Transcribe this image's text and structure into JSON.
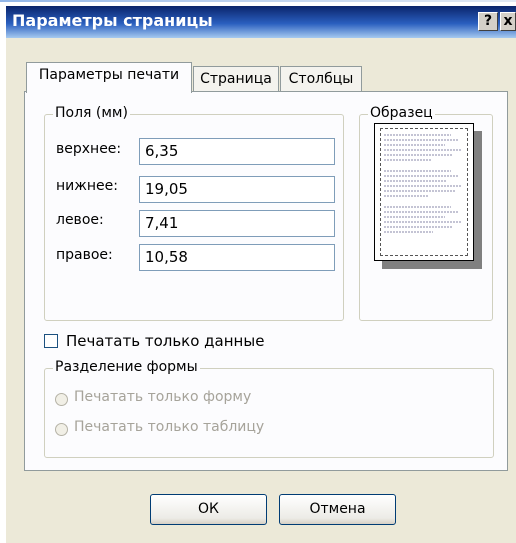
{
  "window": {
    "title": "Параметры страницы",
    "help_label": "?",
    "close_label": "x"
  },
  "tabs": [
    {
      "label": "Параметры печати",
      "active": true
    },
    {
      "label": "Страница",
      "active": false
    },
    {
      "label": "Столбцы",
      "active": false
    }
  ],
  "margins": {
    "legend": "Поля (мм)",
    "top": {
      "label": "верхнее:",
      "value": "6,35"
    },
    "bottom": {
      "label": "нижнее:",
      "value": "19,05"
    },
    "left": {
      "label": "левое:",
      "value": "7,41"
    },
    "right": {
      "label": "правое:",
      "value": "10,58"
    }
  },
  "preview": {
    "legend": "Образец"
  },
  "print_data_only": {
    "label": "Печатать только данные",
    "checked": false
  },
  "split_form": {
    "legend": "Разделение формы",
    "options": [
      {
        "label": "Печатать только форму",
        "selected": false,
        "disabled": true
      },
      {
        "label": "Печатать только таблицу",
        "selected": false,
        "disabled": true
      }
    ]
  },
  "buttons": {
    "ok_label": "ОК",
    "cancel_label": "Отмена"
  },
  "colors": {
    "titlebar_start": "#0a246a",
    "dialog_bg": "#ece9d8",
    "panel_bg": "#fcfcfe"
  }
}
